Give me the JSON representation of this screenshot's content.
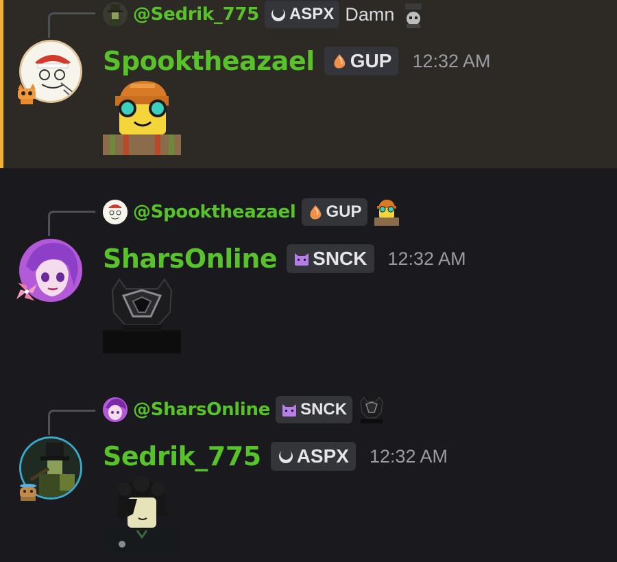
{
  "messages": [
    {
      "reply": {
        "mention": "@Sedrik_775",
        "tag": "ASPX",
        "tag_icon": "crescent-icon",
        "text": "Damn"
      },
      "author": {
        "name": "Spooktheazael",
        "tag": "GUP",
        "tag_icon": "orange-blob-icon"
      },
      "time": "12:32 AM",
      "highlighted": true,
      "emoji": "builder-noob-emoji"
    },
    {
      "reply": {
        "mention": "@Spooktheazael",
        "tag": "GUP",
        "tag_icon": "orange-blob-icon"
      },
      "author": {
        "name": "SharsOnline",
        "tag": "SNCK",
        "tag_icon": "purple-cat-icon"
      },
      "time": "12:32 AM",
      "highlighted": false,
      "emoji": "dark-helmet-emoji"
    },
    {
      "reply": {
        "mention": "@SharsOnline",
        "tag": "SNCK",
        "tag_icon": "purple-cat-icon"
      },
      "author": {
        "name": "Sedrik_775",
        "tag": "ASPX",
        "tag_icon": "crescent-icon"
      },
      "time": "12:32 AM",
      "highlighted": false,
      "emoji": "dark-hair-avatar-emoji"
    }
  ],
  "colors": {
    "background": "#1a1a1e",
    "highlight_bg": "#2d2a25",
    "highlight_bar": "#f0b232",
    "username": "#57c229",
    "timestamp": "#9b9ca3",
    "tag_bg": "#34353b"
  }
}
